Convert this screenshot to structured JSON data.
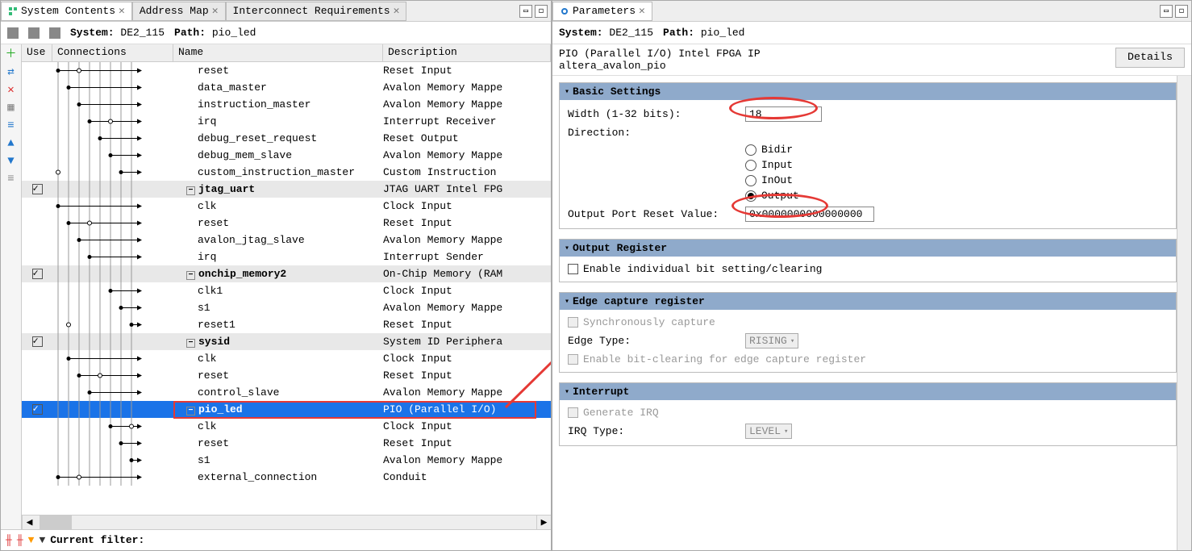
{
  "left": {
    "tabs": [
      {
        "label": "System Contents",
        "active": true
      },
      {
        "label": "Address Map",
        "active": false
      },
      {
        "label": "Interconnect Requirements",
        "active": false
      }
    ],
    "breadcrumb": {
      "system_label": "System:",
      "system_value": "DE2_115",
      "path_label": "Path:",
      "path_value": "pio_led"
    },
    "columns": {
      "use": "Use",
      "connections": "Connections",
      "name": "Name",
      "description": "Description"
    },
    "rows": [
      {
        "name": "reset",
        "desc": "Reset Input"
      },
      {
        "name": "data_master",
        "desc": "Avalon Memory Mappe"
      },
      {
        "name": "instruction_master",
        "desc": "Avalon Memory Mappe"
      },
      {
        "name": "irq",
        "desc": "Interrupt Receiver"
      },
      {
        "name": "debug_reset_request",
        "desc": "Reset Output"
      },
      {
        "name": "debug_mem_slave",
        "desc": "Avalon Memory Mappe"
      },
      {
        "name": "custom_instruction_master",
        "desc": "Custom Instruction"
      },
      {
        "parent": true,
        "use": true,
        "name": "jtag_uart",
        "desc": "JTAG UART Intel FPG"
      },
      {
        "name": "clk",
        "desc": "Clock Input"
      },
      {
        "name": "reset",
        "desc": "Reset Input"
      },
      {
        "name": "avalon_jtag_slave",
        "desc": "Avalon Memory Mappe"
      },
      {
        "name": "irq",
        "desc": "Interrupt Sender"
      },
      {
        "parent": true,
        "use": true,
        "name": "onchip_memory2",
        "desc": "On-Chip Memory (RAM"
      },
      {
        "name": "clk1",
        "desc": "Clock Input"
      },
      {
        "name": "s1",
        "desc": "Avalon Memory Mappe"
      },
      {
        "name": "reset1",
        "desc": "Reset Input"
      },
      {
        "parent": true,
        "use": true,
        "name": "sysid",
        "desc": "System ID Periphera"
      },
      {
        "name": "clk",
        "desc": "Clock Input"
      },
      {
        "name": "reset",
        "desc": "Reset Input"
      },
      {
        "name": "control_slave",
        "desc": "Avalon Memory Mappe"
      },
      {
        "parent": true,
        "use": true,
        "selected": true,
        "name": "pio_led",
        "desc": "PIO (Parallel I/O)"
      },
      {
        "name": "clk",
        "desc": "Clock Input"
      },
      {
        "name": "reset",
        "desc": "Reset Input"
      },
      {
        "name": "s1",
        "desc": "Avalon Memory Mappe"
      },
      {
        "name": "external_connection",
        "desc": "Conduit"
      }
    ],
    "filter_label": "Current filter:"
  },
  "right": {
    "tab": "Parameters",
    "breadcrumb": {
      "system_label": "System:",
      "system_value": "DE2_115",
      "path_label": "Path:",
      "path_value": "pio_led"
    },
    "header": {
      "line1": "PIO (Parallel I/O) Intel FPGA IP",
      "line2": "altera_avalon_pio",
      "details_btn": "Details"
    },
    "basic_settings": {
      "title": "Basic Settings",
      "width_label": "Width (1-32 bits):",
      "width_value": "18",
      "direction_label": "Direction:",
      "direction_options": [
        "Bidir",
        "Input",
        "InOut",
        "Output"
      ],
      "direction_selected": "Output",
      "reset_label": "Output Port Reset Value:",
      "reset_value": "0x0000000000000000"
    },
    "output_register": {
      "title": "Output Register",
      "enable_bit_label": "Enable individual bit setting/clearing"
    },
    "edge_capture": {
      "title": "Edge capture register",
      "sync_label": "Synchronously capture",
      "edge_type_label": "Edge Type:",
      "edge_type_value": "RISING",
      "bitclear_label": "Enable bit-clearing for edge capture register"
    },
    "interrupt": {
      "title": "Interrupt",
      "gen_irq_label": "Generate IRQ",
      "irq_type_label": "IRQ Type:",
      "irq_type_value": "LEVEL"
    }
  }
}
